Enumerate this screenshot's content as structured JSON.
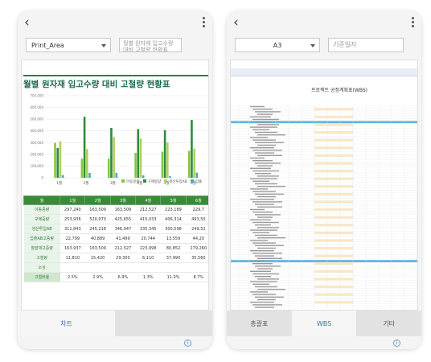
{
  "left_phone": {
    "back_icon": "chevron-left-icon",
    "menu_icon": "more-vertical-icon",
    "range_select": "Print_Area",
    "description": "월별 원자재 입고수량 대비 고철량 현황표",
    "sheet_title": "월별 원자재 입고수량 대비 고철량 현황표",
    "chart_data": {
      "type": "bar",
      "categories": [
        "1월",
        "2월",
        "3월",
        "4월",
        "5월",
        "6월"
      ],
      "series": [
        {
          "name": "이동중량",
          "values": [
            297240,
            163509,
            163509,
            212527,
            223189,
            229720
          ]
        },
        {
          "name": "구매중량",
          "values": [
            253936,
            520970,
            425655,
            415033,
            406314,
            493504
          ]
        },
        {
          "name": "생산투입AB",
          "values": [
            311843,
            245218,
            346947,
            335345,
            300598,
            249520
          ]
        },
        {
          "name": "입출AB",
          "values": [
            22799,
            40889,
            41499,
            20744,
            13559,
            44200
          ]
        }
      ],
      "ylim": [
        0,
        700000
      ],
      "y_ticks": [
        "700,000",
        "600,000",
        "500,000",
        "400,000",
        "300,000",
        "200,000",
        "100,000",
        "0"
      ],
      "legend_labels": [
        "이동중량",
        "구매중량",
        "생산투입AB",
        "입출"
      ]
    },
    "table": {
      "header": [
        "월",
        "1월",
        "2월",
        "3월",
        "4월",
        "5월",
        "6월"
      ],
      "rows": [
        [
          "이동중량",
          "297,240",
          "163,509",
          "163,509",
          "212,527",
          "223,189",
          "229,7"
        ],
        [
          "구매중량",
          "253,936",
          "520,970",
          "425,655",
          "415,033",
          "406,314",
          "493,50"
        ],
        [
          "생산투입AB",
          "311,843",
          "245,218",
          "346,947",
          "335,345",
          "300,598",
          "249,52"
        ],
        [
          "입출AB고중량",
          "22,799",
          "40,889",
          "41,499",
          "20,744",
          "13,559",
          "44,20"
        ],
        [
          "월말재고중량",
          "163,937",
          "163,509",
          "212,527",
          "223,998",
          "80,852",
          "279,260"
        ],
        [
          "고철량",
          "11,810",
          "15,420",
          "29,300",
          "6,110",
          "37,990",
          "35,560"
        ],
        [
          "소싱",
          "",
          "",
          "",
          "",
          "",
          ""
        ],
        [
          "고철비율",
          "2.5%",
          "2.9%",
          "6.9%",
          "1.3%",
          "11.0%",
          "8.7%"
        ]
      ]
    },
    "tabs": [
      "차트"
    ],
    "active_tab": "차트"
  },
  "right_phone": {
    "back_icon": "chevron-left-icon",
    "menu_icon": "more-vertical-icon",
    "cell_select": "A3",
    "cell_input_placeholder": "기준일자",
    "sheet_title": "프로젝트 공정계획표(WBS)",
    "tabs": [
      "총괄표",
      "WBS",
      "기타"
    ],
    "active_tab": "WBS"
  }
}
